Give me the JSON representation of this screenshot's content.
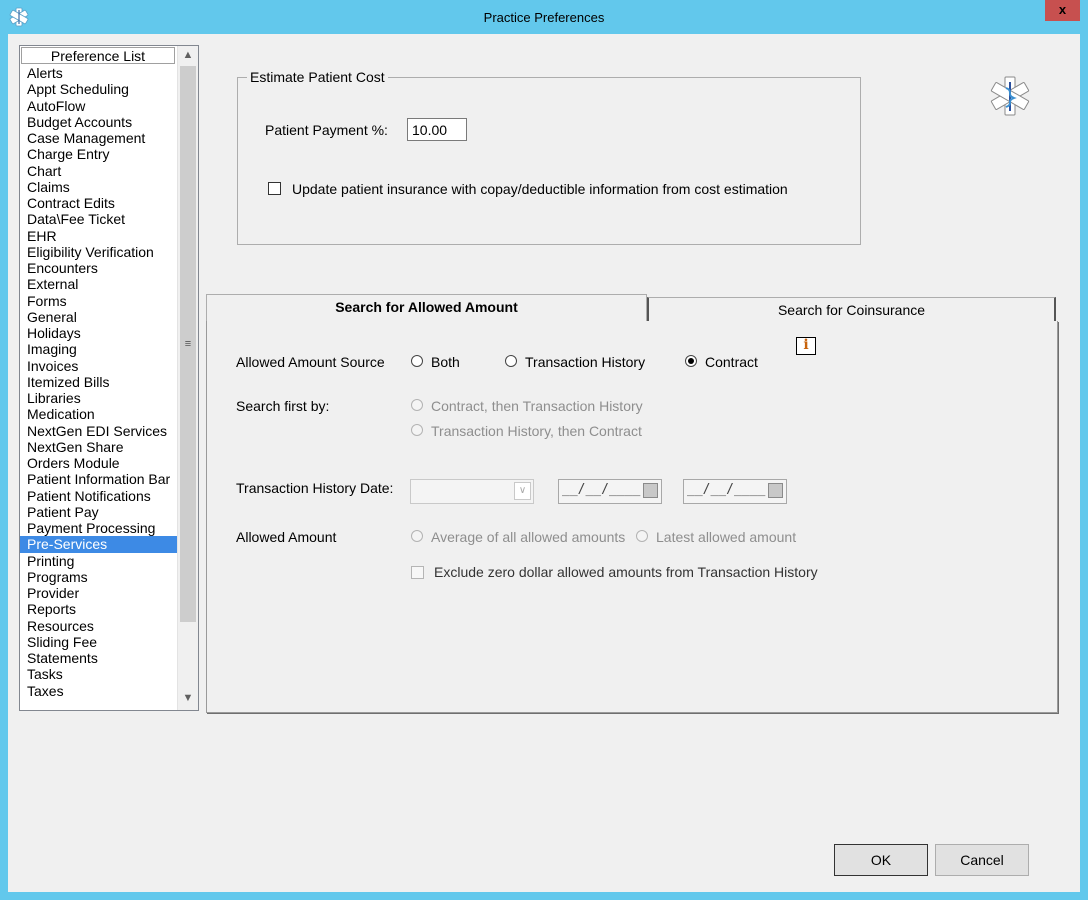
{
  "window": {
    "title": "Practice Preferences",
    "close_label": "x"
  },
  "preference_list": {
    "header": "Preference List",
    "selected": "Pre-Services",
    "items": [
      "Alerts",
      "Appt Scheduling",
      "AutoFlow",
      "Budget Accounts",
      "Case Management",
      "Charge Entry",
      "Chart",
      "Claims",
      "Contract Edits",
      "Data\\Fee Ticket",
      "EHR",
      "Eligibility Verification",
      "Encounters",
      "External",
      "Forms",
      "General",
      "Holidays",
      "Imaging",
      "Invoices",
      "Itemized Bills",
      "Libraries",
      "Medication",
      "NextGen EDI Services",
      "NextGen Share",
      "Orders Module",
      "Patient Information Bar",
      "Patient Notifications",
      "Patient Pay",
      "Payment Processing",
      "Pre-Services",
      "Printing",
      "Programs",
      "Provider",
      "Reports",
      "Resources",
      "Sliding Fee",
      "Statements",
      "Tasks",
      "Taxes"
    ]
  },
  "estimate": {
    "group_title": "Estimate Patient Cost",
    "payment_label": "Patient Payment %:",
    "payment_value": "10.00",
    "update_checkbox_label": "Update patient insurance with copay/deductible information from cost estimation",
    "update_checked": false
  },
  "tabs": {
    "active": "Search for Allowed Amount",
    "inactive": "Search for Coinsurance"
  },
  "allowed_amount_tab": {
    "source_label": "Allowed Amount Source",
    "source_options": [
      "Both",
      "Transaction History",
      "Contract"
    ],
    "source_selected": "Contract",
    "search_first_label": "Search first by:",
    "search_first_options": [
      "Contract, then Transaction History",
      "Transaction History, then Contract"
    ],
    "trans_date_label": "Transaction History Date:",
    "date_from_placeholder": "__/__/____",
    "date_to_placeholder": "__/__/____",
    "allowed_amount_label": "Allowed Amount",
    "allowed_amount_options": [
      "Average of all allowed amounts",
      "Latest allowed amount"
    ],
    "exclude_zero_label": "Exclude zero dollar allowed amounts from Transaction History",
    "info_icon_glyph": "i"
  },
  "buttons": {
    "ok": "OK",
    "cancel": "Cancel"
  },
  "colors": {
    "titlebar": "#62c8ec",
    "selection": "#3d8ae5",
    "close": "#c7504f"
  }
}
